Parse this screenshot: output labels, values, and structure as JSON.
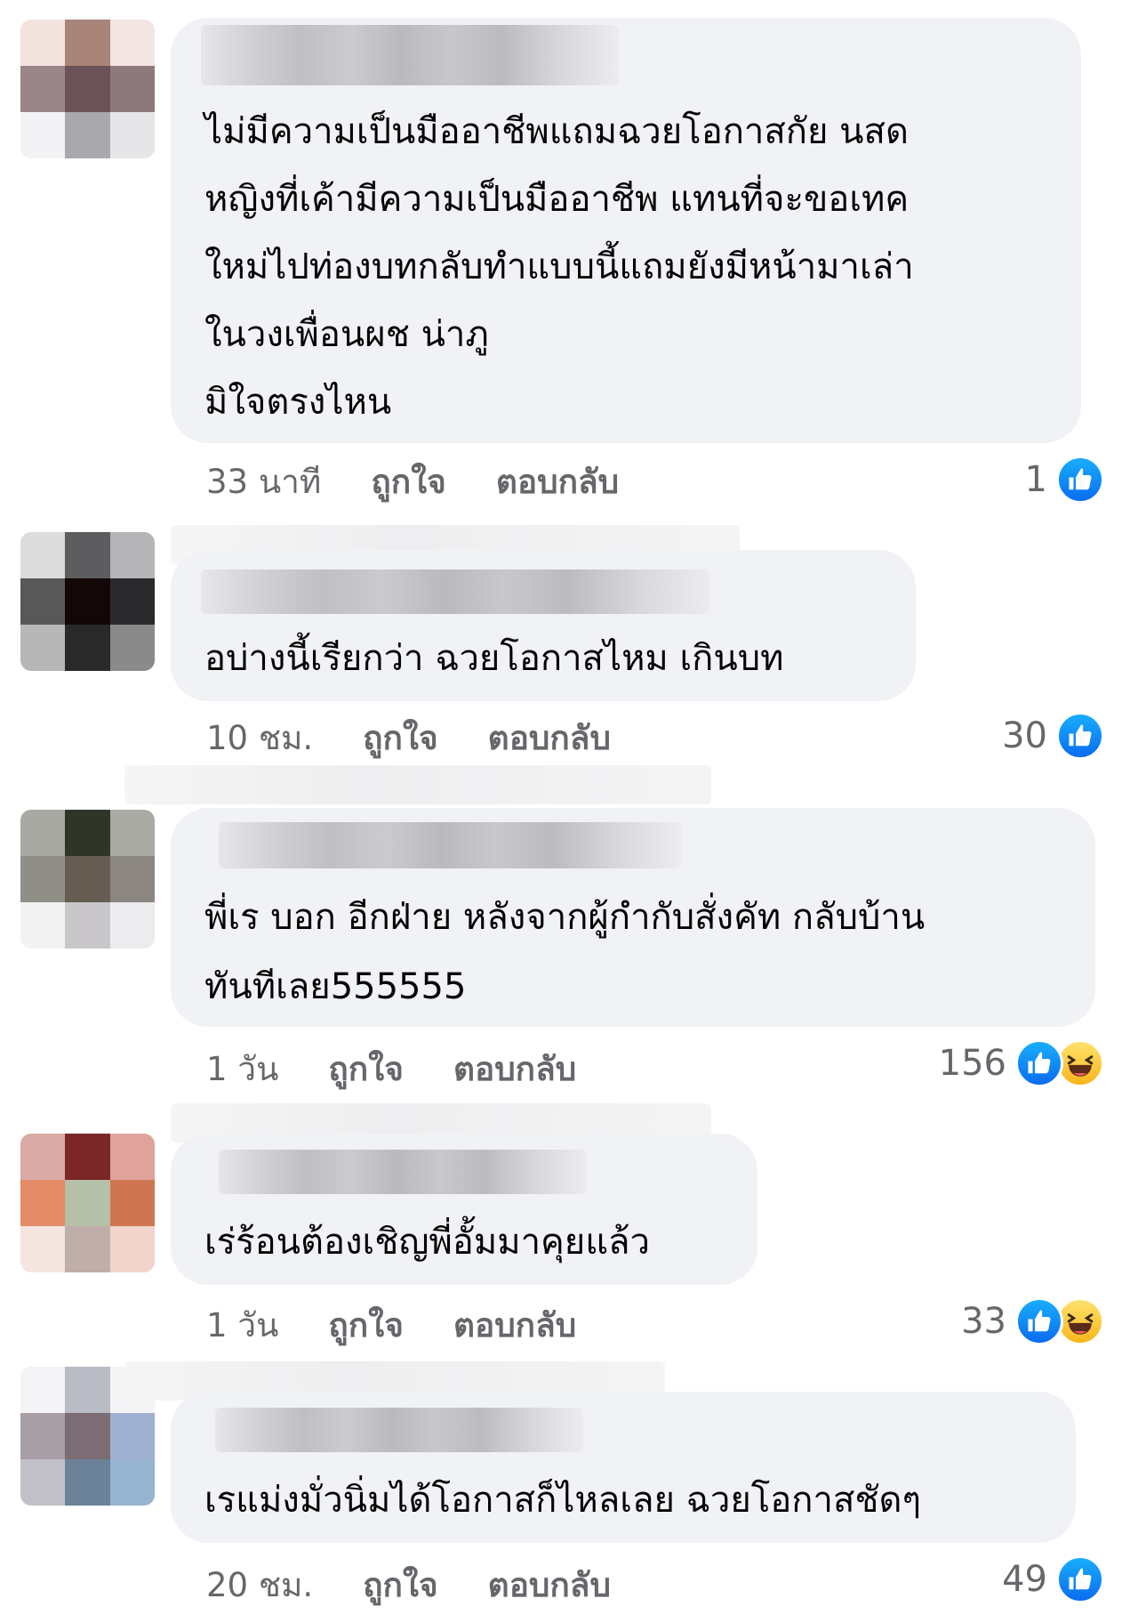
{
  "comments": [
    {
      "text": "ไม่มีความเป็นมืออาชีพแถมฉวยโอกาสกัย นสด\nหญิงที่เค้ามีความเป็นมืออาชีพ แทนที่จะขอเทค\nใหม่ไปท่องบทกลับทำแบบนี้แถมยังมีหน้ามาเล่า\nในวงเพื่อนผช น่าภู\nมิใจตรงไหน",
      "time": "33 นาที",
      "like_label": "ถูกใจ",
      "reply_label": "ตอบกลับ",
      "reaction_count": "1",
      "reactions": [
        "like-icon"
      ],
      "avatar_colors": [
        "#f3e3df",
        "#a98478",
        "#f3e5e2",
        "#9a8688",
        "#6b5258",
        "#8d797c",
        "#f3f3f5",
        "#a9a8ad",
        "#e6e6e9"
      ]
    },
    {
      "text": "อบ่างนี้เรียกว่า ฉวยโอกาสไหม เกินบท",
      "time": "10 ชม.",
      "like_label": "ถูกใจ",
      "reply_label": "ตอบกลับ",
      "reaction_count": "30",
      "reactions": [
        "like-icon"
      ],
      "avatar_colors": [
        "#dcdcdc",
        "#5d5d5f",
        "#b5b5b7",
        "#585859",
        "#140708",
        "#2a2a2c",
        "#b7b7b8",
        "#292929",
        "#8a8a8a"
      ]
    },
    {
      "text": "พี่เร บอก อีกฝ่าย หลังจากผู้กำกับสั่งคัท กลับบ้าน\nทันทีเลย555555",
      "time": "1 วัน",
      "like_label": "ถูกใจ",
      "reply_label": "ตอบกลับ",
      "reaction_count": "156",
      "reactions": [
        "like-icon",
        "haha-icon"
      ],
      "avatar_colors": [
        "#a7a9a2",
        "#2f3627",
        "#aaaba4",
        "#8f8f88",
        "#675c52",
        "#8b8780",
        "#f3f3f3",
        "#c9c7c9",
        "#ececee"
      ]
    },
    {
      "text": "เร่ร้อนต้องเชิญพี่อั้มมาคุยแล้ว",
      "time": "1 วัน",
      "like_label": "ถูกใจ",
      "reply_label": "ตอบกลับ",
      "reaction_count": "33",
      "reactions": [
        "like-icon",
        "haha-icon"
      ],
      "avatar_colors": [
        "#daaaa6",
        "#7b2727",
        "#dfa39c",
        "#e48c68",
        "#b6bfa8",
        "#cf7650",
        "#f4e5e1",
        "#c0aeab",
        "#f1d5cc"
      ]
    },
    {
      "text": "เรแม่งมั่วนิ่มได้โอกาสก็ไหลเลย ฉวยโอกาสชัดๆ",
      "time": "20 ชม.",
      "like_label": "ถูกใจ",
      "reply_label": "ตอบกลับ",
      "reaction_count": "49",
      "reactions": [
        "like-icon"
      ],
      "avatar_colors": [
        "#f4f4f6",
        "#b9bbc5",
        "#f4f4f6",
        "#a79ea6",
        "#7c6c74",
        "#9fafcf",
        "#c1c0c8",
        "#6b8298",
        "#96b3cf"
      ]
    }
  ]
}
